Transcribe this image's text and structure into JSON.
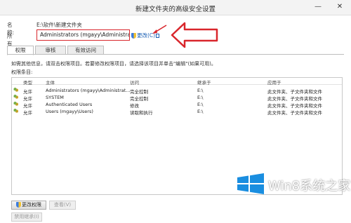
{
  "window": {
    "title": "新建文件夹的高级安全设置",
    "minimize": "—",
    "close": "✕"
  },
  "name_row": {
    "label": "名称:",
    "value": "E:\\软件\\新建文件夹"
  },
  "owner_row": {
    "label": "所有者:",
    "value": "Administrators (mgayy\\Administrators)",
    "change_link": "更改(C)",
    "highlight_color": "#d9262c"
  },
  "tabs": [
    {
      "label": "权限",
      "active": true
    },
    {
      "label": "审核",
      "active": false
    },
    {
      "label": "有效访问",
      "active": false
    }
  ],
  "info_text": "如需其他信息，请双击权限项目。若要修改权限项目，请选择该项目并单击\"编辑\"(如果可用)。",
  "entries_label": "权限条目:",
  "table": {
    "headers": [
      "类型",
      "主体",
      "访问",
      "继承于",
      "应用于"
    ],
    "rows": [
      {
        "type": "允许",
        "principal": "Administrators (mgayy\\Administrat...",
        "access": "完全控制",
        "inherited": "E:\\",
        "applies": "此文件夹、子文件夹和文件"
      },
      {
        "type": "允许",
        "principal": "SYSTEM",
        "access": "完全控制",
        "inherited": "E:\\",
        "applies": "此文件夹、子文件夹和文件"
      },
      {
        "type": "允许",
        "principal": "Authenticated Users",
        "access": "修改",
        "inherited": "E:\\",
        "applies": "此文件夹、子文件夹和文件"
      },
      {
        "type": "允许",
        "principal": "Users (mgayy\\Users)",
        "access": "读取和执行",
        "inherited": "E:\\",
        "applies": "此文件夹、子文件夹和文件"
      }
    ]
  },
  "buttons": {
    "change_permissions": "更改权限",
    "view": "查看(V)",
    "disable_inheritance": "禁用继承(I)"
  },
  "watermark": {
    "text": "Win8系统之家"
  },
  "colors": {
    "accent_blue": "#1a5fb4",
    "arrow_red": "#d9262c"
  }
}
